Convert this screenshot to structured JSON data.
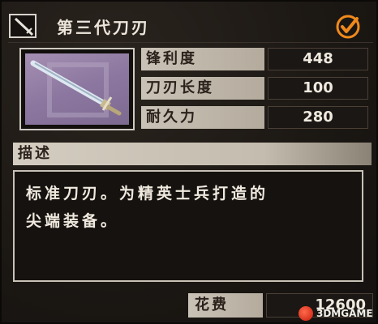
{
  "header": {
    "title": "第三代刀刃",
    "left_icon": "sword-icon",
    "right_icon": "check-icon",
    "accent_color": "#f08a1c"
  },
  "item": {
    "image_icon": "sword-icon",
    "image_bg_color": "#9a86ac"
  },
  "stats": [
    {
      "label": "锋利度",
      "value": "448"
    },
    {
      "label": "刀刃长度",
      "value": "100"
    },
    {
      "label": "耐久力",
      "value": "280"
    }
  ],
  "description": {
    "header": "描述",
    "lines": [
      "标准刀刃。为精英士兵打造的",
      "尖端装备。"
    ]
  },
  "cost": {
    "label": "花费",
    "value": "12600"
  },
  "watermark": {
    "text": "3DMGAME"
  }
}
